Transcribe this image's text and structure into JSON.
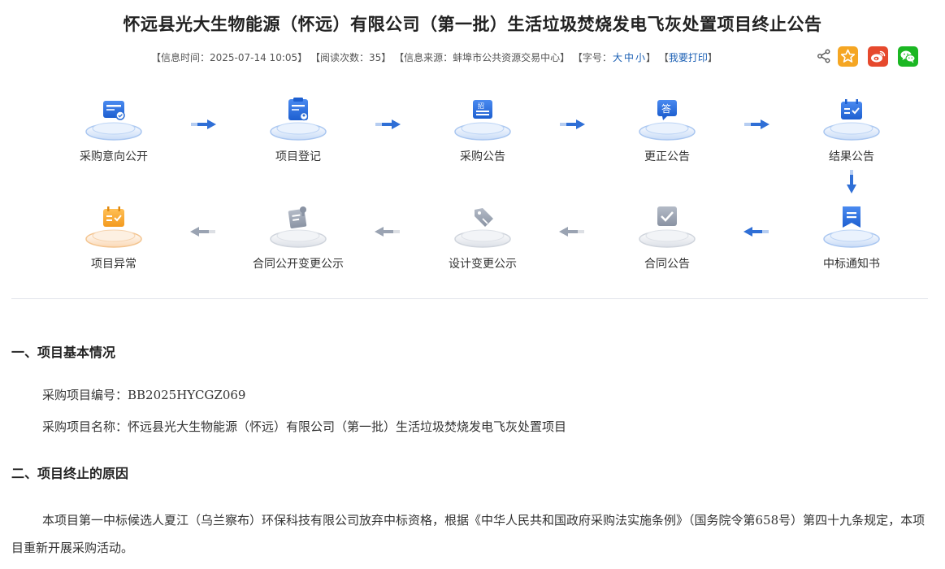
{
  "title": "怀远县光大生物能源（怀远）有限公司（第一批）生活垃圾焚烧发电飞灰处置项目终止公告",
  "meta": {
    "time_label": "【信息时间：2025-07-14 10:05】",
    "read_label": "【阅读次数：35】",
    "source_label": "【信息来源：蚌埠市公共资源交易中心】",
    "font_label_open": "【字号：",
    "font_large": "大",
    "font_medium": "中",
    "font_small": "小",
    "font_label_close": "】",
    "print_open": "【",
    "print_label": "我要打印",
    "print_close": "】"
  },
  "icons": {
    "share": "share-icon",
    "favorite": "star-icon",
    "weibo": "weibo-icon",
    "wechat": "wechat-icon"
  },
  "colors": {
    "accent_blue": "#2f6fd6",
    "favorite": "#f5a623",
    "weibo": "#e6492d",
    "wechat": "#1bb723",
    "inactive": "#9aa3b2",
    "exception": "#f0a030"
  },
  "flow": {
    "row1": [
      "采购意向公开",
      "项目登记",
      "采购公告",
      "更正公告",
      "结果公告"
    ],
    "row2": [
      "中标通知书",
      "合同公告",
      "设计变更公示",
      "合同公开变更公示",
      "项目异常"
    ],
    "badge_zhao": "招",
    "badge_da": "答"
  },
  "section1": {
    "heading": "一、项目基本情况",
    "line1": "采购项目编号：BB2025HYCGZ069",
    "line2": "采购项目名称：怀远县光大生物能源（怀远）有限公司（第一批）生活垃圾焚烧发电飞灰处置项目"
  },
  "section2": {
    "heading": "二、项目终止的原因",
    "body": "本项目第一中标候选人夏江（乌兰察布）环保科技有限公司放弃中标资格，根据《中华人民共和国政府采购法实施条例》（国务院令第658号）第四十九条规定，本项目重新开展采购活动。"
  }
}
